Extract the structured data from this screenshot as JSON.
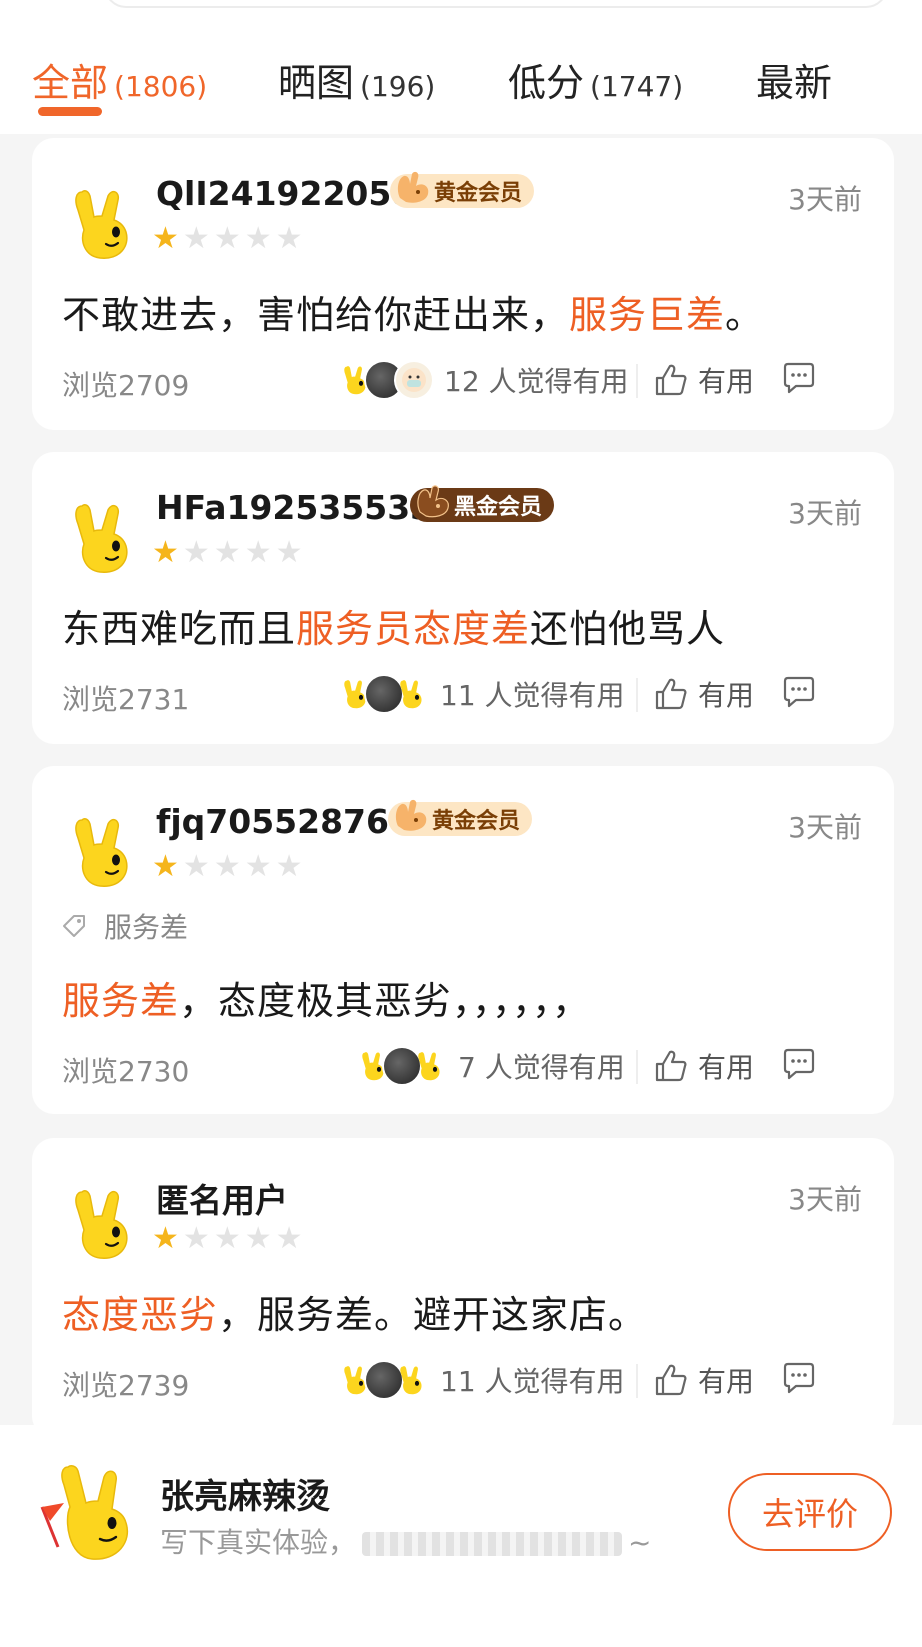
{
  "tabs": [
    {
      "label": "全部",
      "count": "(1806)",
      "active": true
    },
    {
      "label": "晒图",
      "count": "(196)",
      "active": false
    },
    {
      "label": "低分",
      "count": "(1747)",
      "active": false
    },
    {
      "label": "最新",
      "count": "",
      "active": false
    }
  ],
  "colors": {
    "accent": "#f0662a",
    "star": "#f5b51c",
    "gold_badge": "#fde6c4",
    "black_badge": "#6b3a16"
  },
  "reviews": [
    {
      "username": "QlI241922058",
      "badge": "黄金会员",
      "time": "3天前",
      "rating": 1,
      "text_parts": [
        "不敢进去，害怕给你赶出来，",
        "服务巨差",
        "。"
      ],
      "views": "浏览2709",
      "helpful": "12 人觉得有用",
      "useful_label": "有用"
    },
    {
      "username": "HFa192535533",
      "badge": "黑金会员",
      "time": "3天前",
      "rating": 1,
      "text_parts": [
        "东西难吃而且",
        "服务员态度差",
        "还怕他骂人"
      ],
      "views": "浏览2731",
      "helpful": "11 人觉得有用",
      "useful_label": "有用"
    },
    {
      "username": "fjq705528766",
      "badge": "黄金会员",
      "time": "3天前",
      "rating": 1,
      "tag": "服务差",
      "text_parts": [
        "服务差",
        "，态度极其恶劣，，，，，，"
      ],
      "views": "浏览2730",
      "helpful": "7 人觉得有用",
      "useful_label": "有用"
    },
    {
      "username": "匿名用户",
      "time": "3天前",
      "rating": 1,
      "text_parts": [
        "态度恶劣",
        "，服务差。避开这家店。"
      ],
      "views": "浏览2739",
      "helpful": "11 人觉得有用",
      "useful_label": "有用"
    }
  ],
  "bottom": {
    "shop_name": "张亮麻辣烫",
    "placeholder_start": "写下真实体验，",
    "placeholder_end": "~",
    "button": "去评价"
  }
}
